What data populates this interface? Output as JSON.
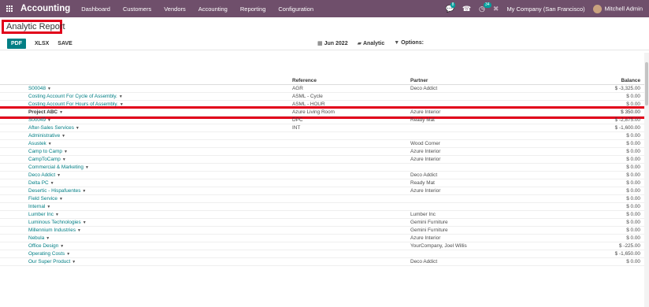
{
  "app": {
    "title": "Accounting"
  },
  "topnav": {
    "items": [
      "Dashboard",
      "Customers",
      "Vendors",
      "Accounting",
      "Reporting",
      "Configuration"
    ],
    "chat_count": "8",
    "activity_count": "34",
    "company": "My Company (San Francisco)",
    "user": "Mitchell Admin"
  },
  "page": {
    "title": "Analytic Report"
  },
  "toolbar": {
    "pdf": "PDF",
    "xlsx": "XLSX",
    "save": "SAVE"
  },
  "filters": {
    "date": "Jun 2022",
    "analytic": "Analytic",
    "options": "Options:"
  },
  "table": {
    "headers": {
      "reference": "Reference",
      "partner": "Partner",
      "balance": "Balance"
    },
    "rows": [
      {
        "name": "S00048",
        "reference": "AGR",
        "partner": "Deco Addict",
        "balance": "$ -3,325.00"
      },
      {
        "name": "Costing Account For Cycle of Assembly.",
        "reference": "ASML - Cycle",
        "partner": "",
        "balance": "$ 0.00"
      },
      {
        "name": "Costing Account For Hours of Assembly.",
        "reference": "ASML - HOUR",
        "partner": "",
        "balance": "$ 0.00"
      },
      {
        "name": "Project ABC",
        "reference": "Azure Living Room",
        "partner": "Azure Interior",
        "balance": "$ 350.00"
      },
      {
        "name": "S00049",
        "reference": "DPC",
        "partner": "Ready Mat",
        "balance": "$ -2,875.00"
      },
      {
        "name": "After-Sales Services",
        "reference": "INT",
        "partner": "",
        "balance": "$ -1,600.00"
      },
      {
        "name": "Administrative",
        "reference": "",
        "partner": "",
        "balance": "$ 0.00"
      },
      {
        "name": "Asustek",
        "reference": "",
        "partner": "Wood Corner",
        "balance": "$ 0.00"
      },
      {
        "name": "Camp to Camp",
        "reference": "",
        "partner": "Azure Interior",
        "balance": "$ 0.00"
      },
      {
        "name": "CampToCamp",
        "reference": "",
        "partner": "Azure Interior",
        "balance": "$ 0.00"
      },
      {
        "name": "Commercial & Marketing",
        "reference": "",
        "partner": "",
        "balance": "$ 0.00"
      },
      {
        "name": "Deco Addict",
        "reference": "",
        "partner": "Deco Addict",
        "balance": "$ 0.00"
      },
      {
        "name": "Delta PC",
        "reference": "",
        "partner": "Ready Mat",
        "balance": "$ 0.00"
      },
      {
        "name": "Desertic - Hispafuentes",
        "reference": "",
        "partner": "Azure Interior",
        "balance": "$ 0.00"
      },
      {
        "name": "Field Service",
        "reference": "",
        "partner": "",
        "balance": "$ 0.00"
      },
      {
        "name": "Internal",
        "reference": "",
        "partner": "",
        "balance": "$ 0.00"
      },
      {
        "name": "Lumber Inc",
        "reference": "",
        "partner": "Lumber Inc",
        "balance": "$ 0.00"
      },
      {
        "name": "Luminous Technologies",
        "reference": "",
        "partner": "Gemini Furniture",
        "balance": "$ 0.00"
      },
      {
        "name": "Millennium Industries",
        "reference": "",
        "partner": "Gemini Furniture",
        "balance": "$ 0.00"
      },
      {
        "name": "Nebula",
        "reference": "",
        "partner": "Azure Interior",
        "balance": "$ 0.00"
      },
      {
        "name": "Office Design",
        "reference": "",
        "partner": "YourCompany, Joel Willis",
        "balance": "$ -225.00"
      },
      {
        "name": "Operating Costs",
        "reference": "",
        "partner": "",
        "balance": "$ -1,650.00"
      },
      {
        "name": "Our Super Product",
        "reference": "",
        "partner": "Deco Addict",
        "balance": "$ 0.00"
      }
    ]
  }
}
